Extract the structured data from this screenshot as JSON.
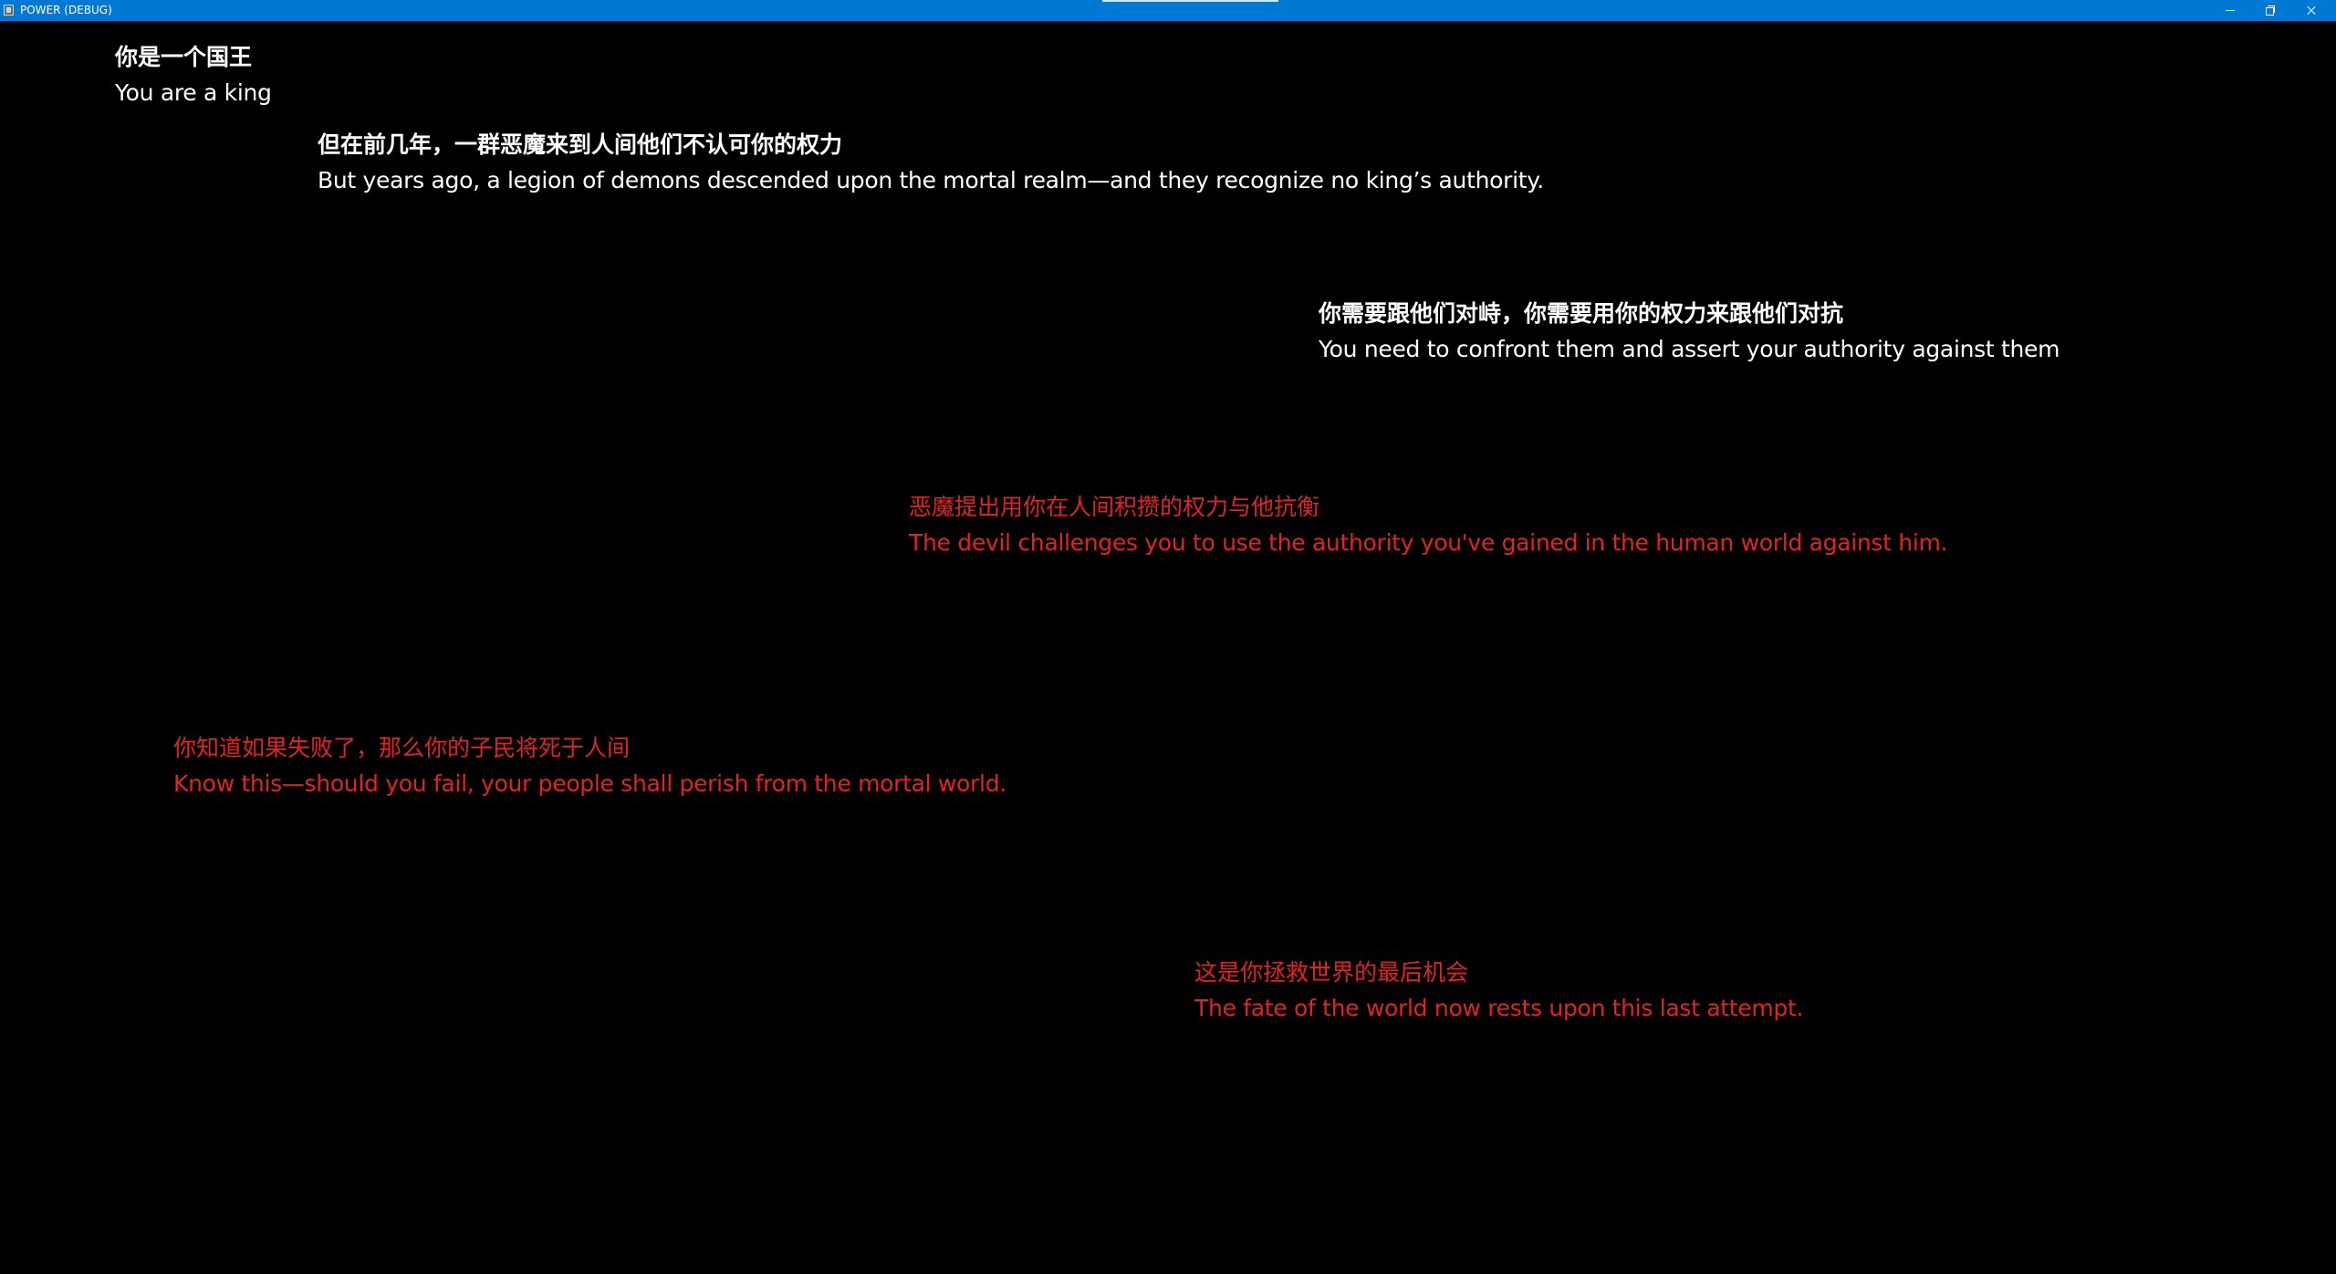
{
  "window": {
    "title": "POWER (DEBUG)"
  },
  "colors": {
    "titlebar": "#0078d4",
    "background": "#000000",
    "text_white": "#ffffff",
    "text_red": "#e02424"
  },
  "dialogue": [
    {
      "zh": "你是一个国王",
      "en": "You are a king",
      "color": "white"
    },
    {
      "zh": "但在前几年，一群恶魔来到人间他们不认可你的权力",
      "en": "But years ago, a legion of demons descended upon the mortal realm—and they recognize no king’s authority.",
      "color": "white"
    },
    {
      "zh": "你需要跟他们对峙，你需要用你的权力来跟他们对抗",
      "en": "You need to confront them and assert your authority against them",
      "color": "white"
    },
    {
      "zh": "恶魔提出用你在人间积攒的权力与他抗衡",
      "en": "The devil challenges you to use the authority you've gained in the human world against him.",
      "color": "red"
    },
    {
      "zh": "你知道如果失败了，那么你的子民将死于人间",
      "en": "Know this—should you fail, your people shall perish from the mortal world.",
      "color": "red"
    },
    {
      "zh": "这是你拯救世界的最后机会",
      "en": "The fate of the world now rests upon this last attempt.",
      "color": "red"
    }
  ]
}
